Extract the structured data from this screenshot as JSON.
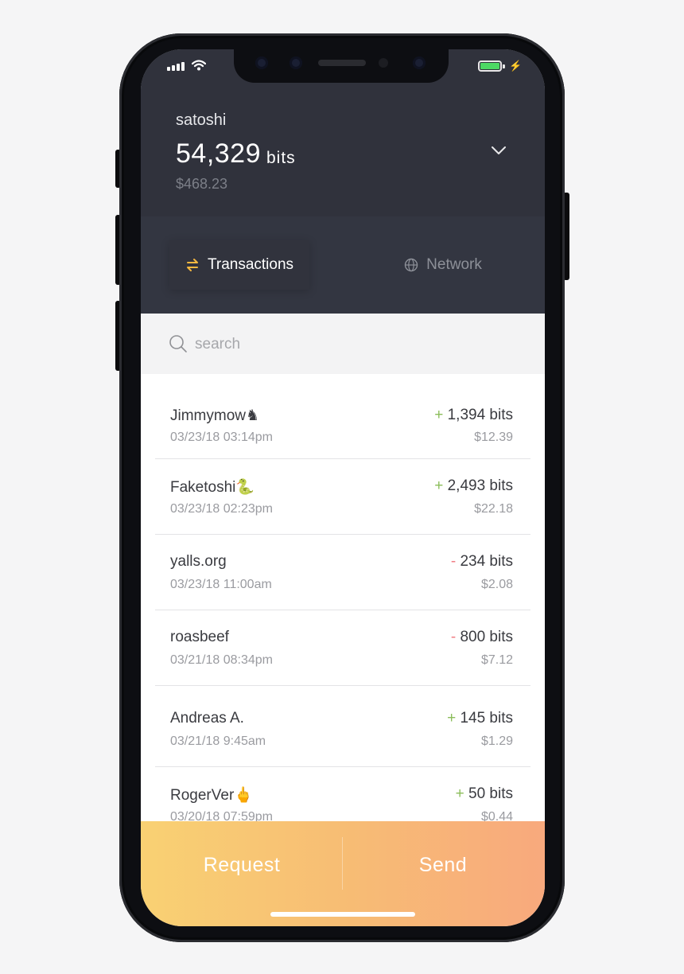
{
  "account": {
    "username": "satoshi",
    "balance": "54,329",
    "balance_unit": "bits",
    "fiat": "$468.23"
  },
  "tabs": [
    {
      "label": "Transactions",
      "active": true,
      "icon": "arrows-exchange-icon"
    },
    {
      "label": "Network",
      "active": false,
      "icon": "globe-icon"
    }
  ],
  "search": {
    "placeholder": "search"
  },
  "transactions": [
    {
      "name": "Jimmymow",
      "emoji": "♞",
      "date": "03/23/18 03:14pm",
      "sign": "+",
      "amount": "1,394 bits",
      "usd": "$12.39"
    },
    {
      "name": "Faketoshi",
      "emoji": "🐍",
      "date": "03/23/18 02:23pm",
      "sign": "+",
      "amount": "2,493 bits",
      "usd": "$22.18"
    },
    {
      "name": "yalls.org",
      "emoji": "",
      "date": "03/23/18 11:00am",
      "sign": "-",
      "amount": "234 bits",
      "usd": "$2.08"
    },
    {
      "name": "roasbeef",
      "emoji": "",
      "date": "03/21/18 08:34pm",
      "sign": "-",
      "amount": "800 bits",
      "usd": "$7.12"
    },
    {
      "name": "Andreas A.",
      "emoji": "",
      "date": "03/21/18 9:45am",
      "sign": "+",
      "amount": "145 bits",
      "usd": "$1.29"
    },
    {
      "name": "RogerVer",
      "emoji": "🖕",
      "date": "03/20/18 07:59pm",
      "sign": "+",
      "amount": "50 bits",
      "usd": "$0.44"
    }
  ],
  "actions": {
    "request": "Request",
    "send": "Send"
  },
  "colors": {
    "header": "#333641",
    "positive": "#8bbd5a",
    "negative": "#f07e84",
    "gradient_start": "#f9d173",
    "gradient_end": "#f8a97d",
    "battery": "#4cd964"
  }
}
